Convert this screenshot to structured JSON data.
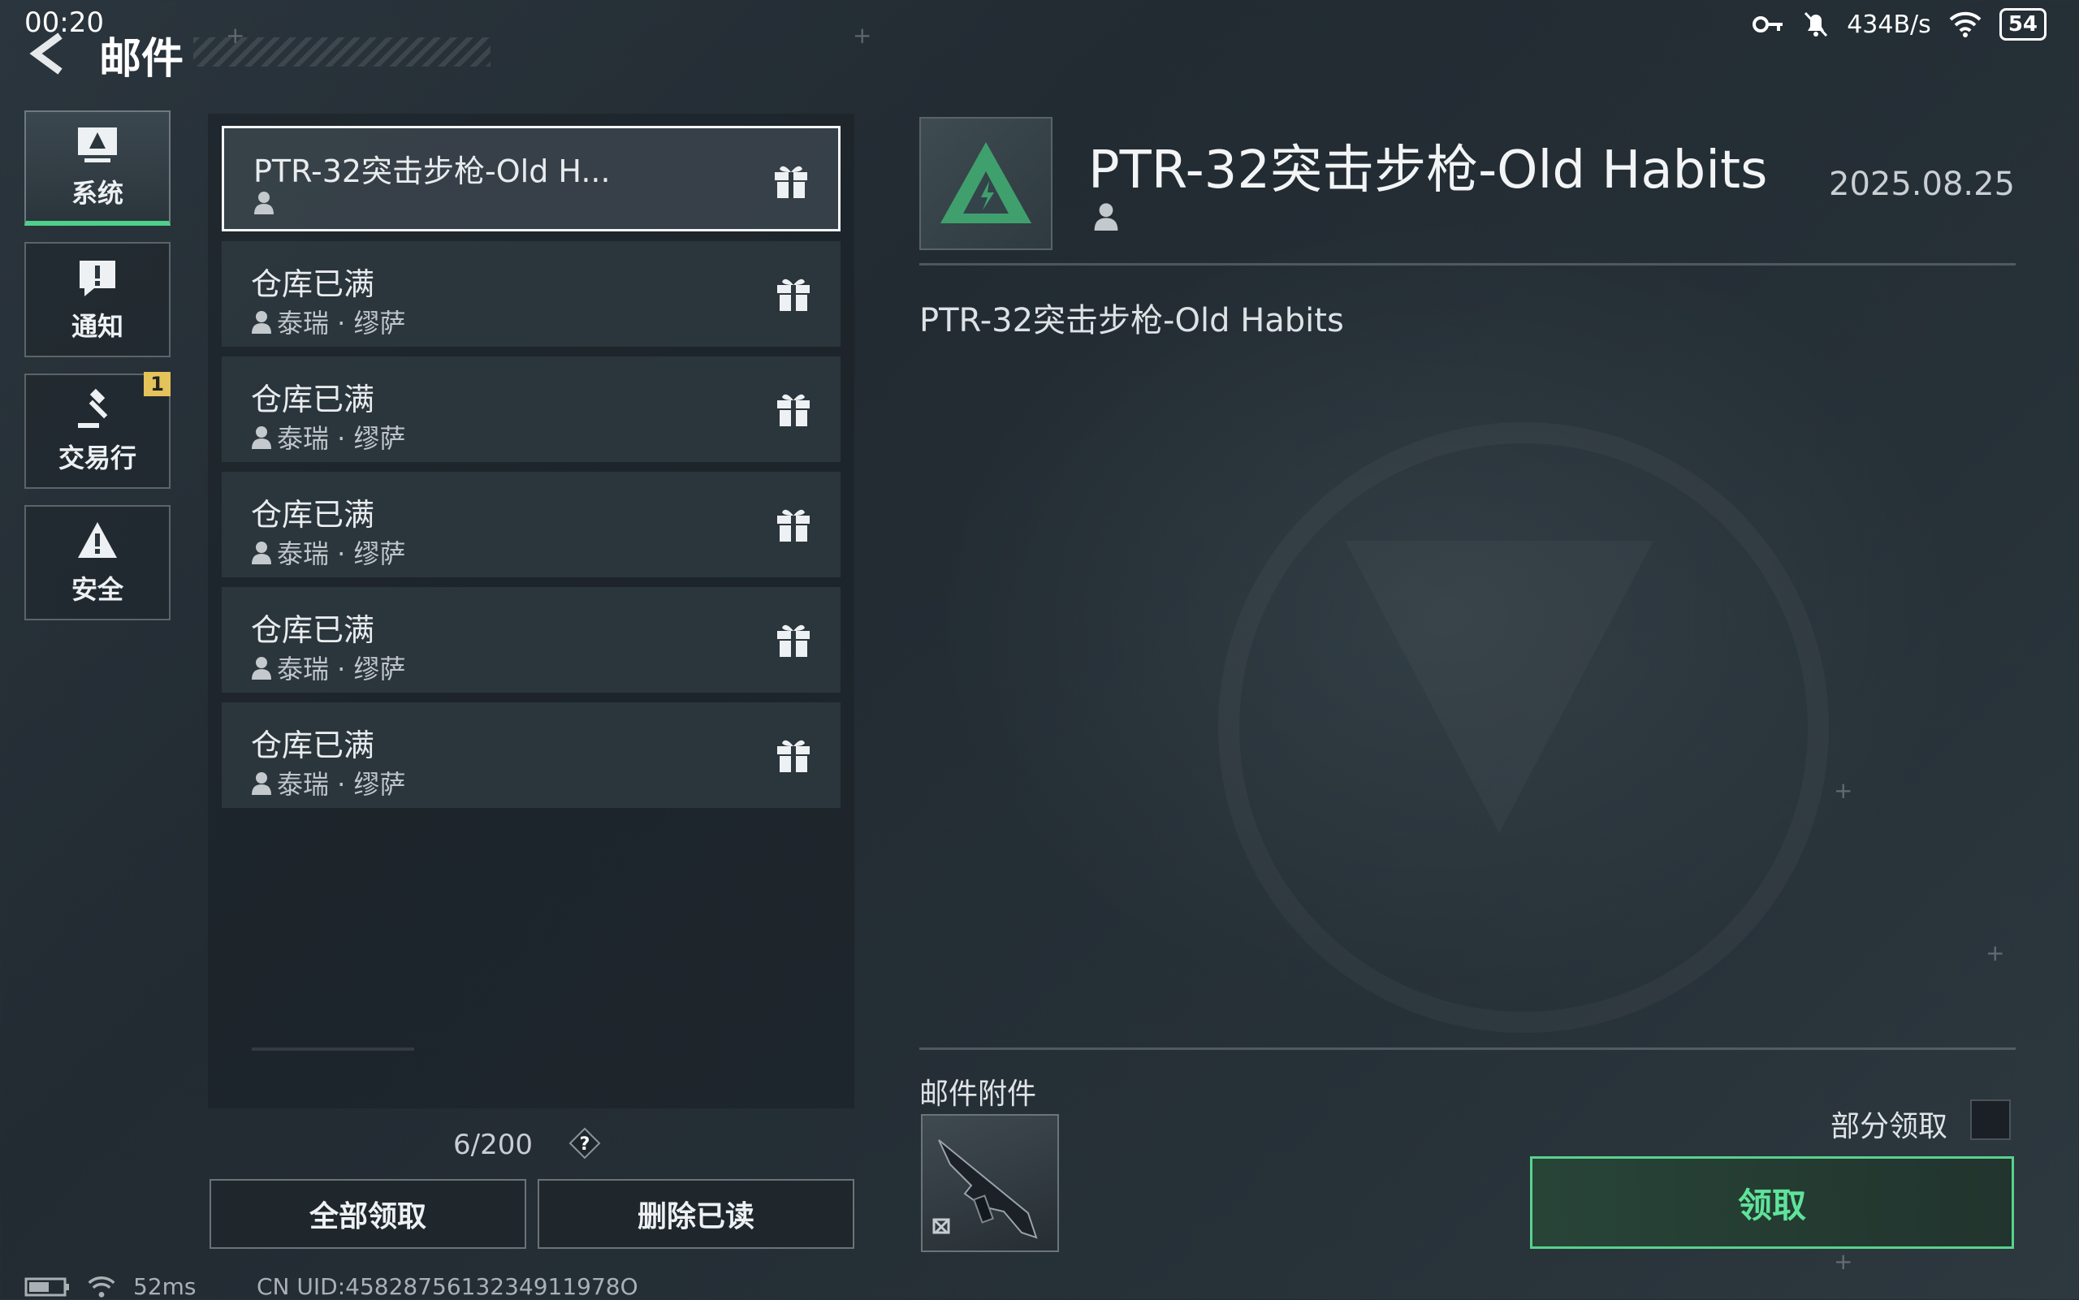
{
  "status_bar": {
    "time": "00:20",
    "net_speed": "434B/s",
    "battery": "54",
    "icons": [
      "key-icon",
      "mute-bell-icon",
      "wifi-icon",
      "battery-icon"
    ]
  },
  "header": {
    "title": "邮件",
    "back_icon": "back-arrow-icon"
  },
  "sidebar": {
    "tabs": [
      {
        "label": "系统",
        "icon": "system-monitor-icon",
        "active": true
      },
      {
        "label": "通知",
        "icon": "notice-icon",
        "active": false
      },
      {
        "label": "交易行",
        "icon": "auction-hammer-icon",
        "active": false,
        "badge": "1"
      },
      {
        "label": "安全",
        "icon": "warning-icon",
        "active": false
      }
    ]
  },
  "mail_list": {
    "items": [
      {
        "title": "PTR-32突击步枪-Old H...",
        "sender": "",
        "selected": true
      },
      {
        "title": "仓库已满",
        "sender": "泰瑞 · 缪萨",
        "selected": false
      },
      {
        "title": "仓库已满",
        "sender": "泰瑞 · 缪萨",
        "selected": false
      },
      {
        "title": "仓库已满",
        "sender": "泰瑞 · 缪萨",
        "selected": false
      },
      {
        "title": "仓库已满",
        "sender": "泰瑞 · 缪萨",
        "selected": false
      },
      {
        "title": "仓库已满",
        "sender": "泰瑞 · 缪萨",
        "selected": false
      }
    ],
    "count": "6/200",
    "help": "?",
    "claim_all": "全部领取",
    "delete_read": "删除已读"
  },
  "detail": {
    "title": "PTR-32突击步枪-Old Habits",
    "date": "2025.08.25",
    "body": "PTR-32突击步枪-Old Habits",
    "attachment_label": "邮件附件",
    "partial_claim": "部分领取",
    "claim_button": "领取",
    "accent_color": "#58d28e"
  },
  "footer": {
    "ping": "52ms",
    "uid": "CN UID:4582875613234911978O"
  }
}
